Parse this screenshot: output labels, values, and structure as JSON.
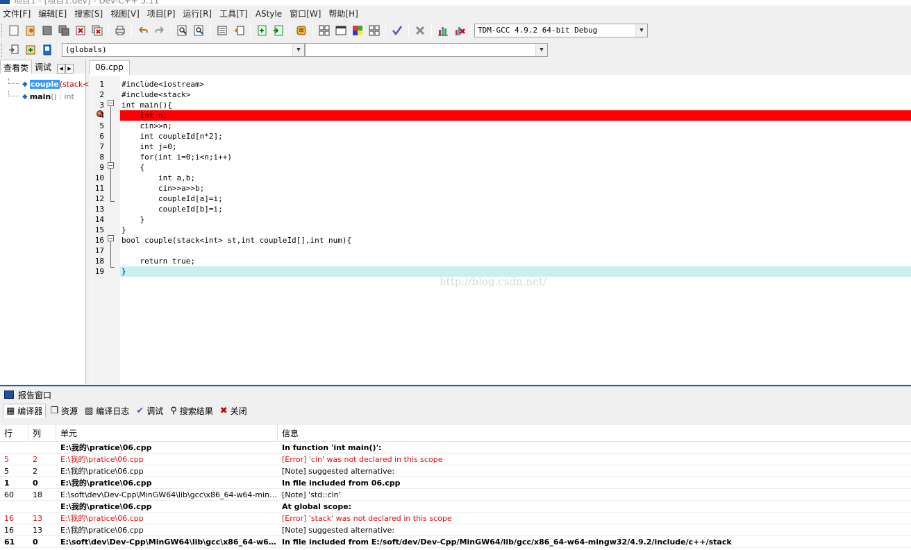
{
  "window": {
    "title": "项目1 - [项目1.dev] - Dev-C++ 5.11"
  },
  "menu": [
    "文件[F]",
    "编辑[E]",
    "搜索[S]",
    "视图[V]",
    "项目[P]",
    "运行[R]",
    "工具[T]",
    "AStyle",
    "窗口[W]",
    "帮助[H]"
  ],
  "toolbar": {
    "compiler_select": "TDM-GCC 4.9.2 64-bit Debug"
  },
  "toolbar2": {
    "scope_select": "(globals)",
    "member_select": ""
  },
  "left_panel": {
    "tabs": [
      "查看类",
      "调试"
    ],
    "items": [
      {
        "name": "couple",
        "signature": "(stack<i"
      },
      {
        "name": "main",
        "signature": "() : int"
      }
    ]
  },
  "editor": {
    "file_tab": "06.cpp",
    "watermark": "http://blog.csdn.net/",
    "lines": [
      {
        "num": "1",
        "text": "#include<iostream>"
      },
      {
        "num": "2",
        "text": "#include<stack>"
      },
      {
        "num": "3",
        "text": "int main(){"
      },
      {
        "num": "4",
        "text": "    int n;"
      },
      {
        "num": "5",
        "text": "    cin>>n;"
      },
      {
        "num": "6",
        "text": "    int coupleId[n*2];"
      },
      {
        "num": "7",
        "text": "    int j=0;"
      },
      {
        "num": "8",
        "text": "    for(int i=0;i<n;i++)"
      },
      {
        "num": "9",
        "text": "    {"
      },
      {
        "num": "10",
        "text": "        int a,b;"
      },
      {
        "num": "11",
        "text": "        cin>>a>>b;"
      },
      {
        "num": "12",
        "text": "        coupleId[a]=i;"
      },
      {
        "num": "13",
        "text": "        coupleId[b]=i;"
      },
      {
        "num": "14",
        "text": "    }"
      },
      {
        "num": "15",
        "text": "}"
      },
      {
        "num": "16",
        "text": "bool couple(stack<int> st,int coupleId[],int num){"
      },
      {
        "num": "17",
        "text": ""
      },
      {
        "num": "18",
        "text": "    return true;"
      },
      {
        "num": "19",
        "text": "}"
      }
    ]
  },
  "report": {
    "title": "报告窗口",
    "tabs": [
      "编译器",
      "资源",
      "编译日志",
      "调试",
      "搜索结果",
      "关闭"
    ],
    "columns": [
      "行",
      "列",
      "单元",
      "信息"
    ],
    "rows": [
      {
        "line": "",
        "col": "",
        "unit": "E:\\我的\\pratice\\06.cpp",
        "msg": "In function 'int main()':",
        "style": "bold"
      },
      {
        "line": "5",
        "col": "2",
        "unit": "E:\\我的\\pratice\\06.cpp",
        "msg": "[Error] 'cin' was not declared in this scope",
        "style": "err"
      },
      {
        "line": "5",
        "col": "2",
        "unit": "E:\\我的\\pratice\\06.cpp",
        "msg": "[Note] suggested alternative:",
        "style": ""
      },
      {
        "line": "1",
        "col": "0",
        "unit": "E:\\我的\\pratice\\06.cpp",
        "msg": "In file included from 06.cpp",
        "style": "bold"
      },
      {
        "line": "60",
        "col": "18",
        "unit": "E:\\soft\\dev\\Dev-Cpp\\MinGW64\\lib\\gcc\\x86_64-w64-mingw32...",
        "msg": "[Note] 'std::cin'",
        "style": ""
      },
      {
        "line": "",
        "col": "",
        "unit": "E:\\我的\\pratice\\06.cpp",
        "msg": "At global scope:",
        "style": "bold"
      },
      {
        "line": "16",
        "col": "13",
        "unit": "E:\\我的\\pratice\\06.cpp",
        "msg": "[Error] 'stack' was not declared in this scope",
        "style": "err"
      },
      {
        "line": "16",
        "col": "13",
        "unit": "E:\\我的\\pratice\\06.cpp",
        "msg": "[Note] suggested alternative:",
        "style": ""
      },
      {
        "line": "61",
        "col": "0",
        "unit": "E:\\soft\\dev\\Dev-Cpp\\MinGW64\\lib\\gcc\\x86_64-w64...",
        "msg": "In file included from E:/soft/dev/Dev-Cpp/MinGW64/lib/gcc/x86_64-w64-mingw32/4.9.2/include/c++/stack",
        "style": "bold"
      }
    ]
  },
  "colors": {
    "breakpoint": "#ff0000",
    "current_line": "#c8f0f0",
    "error_text": "#e01010",
    "selection": "#3399ff"
  }
}
